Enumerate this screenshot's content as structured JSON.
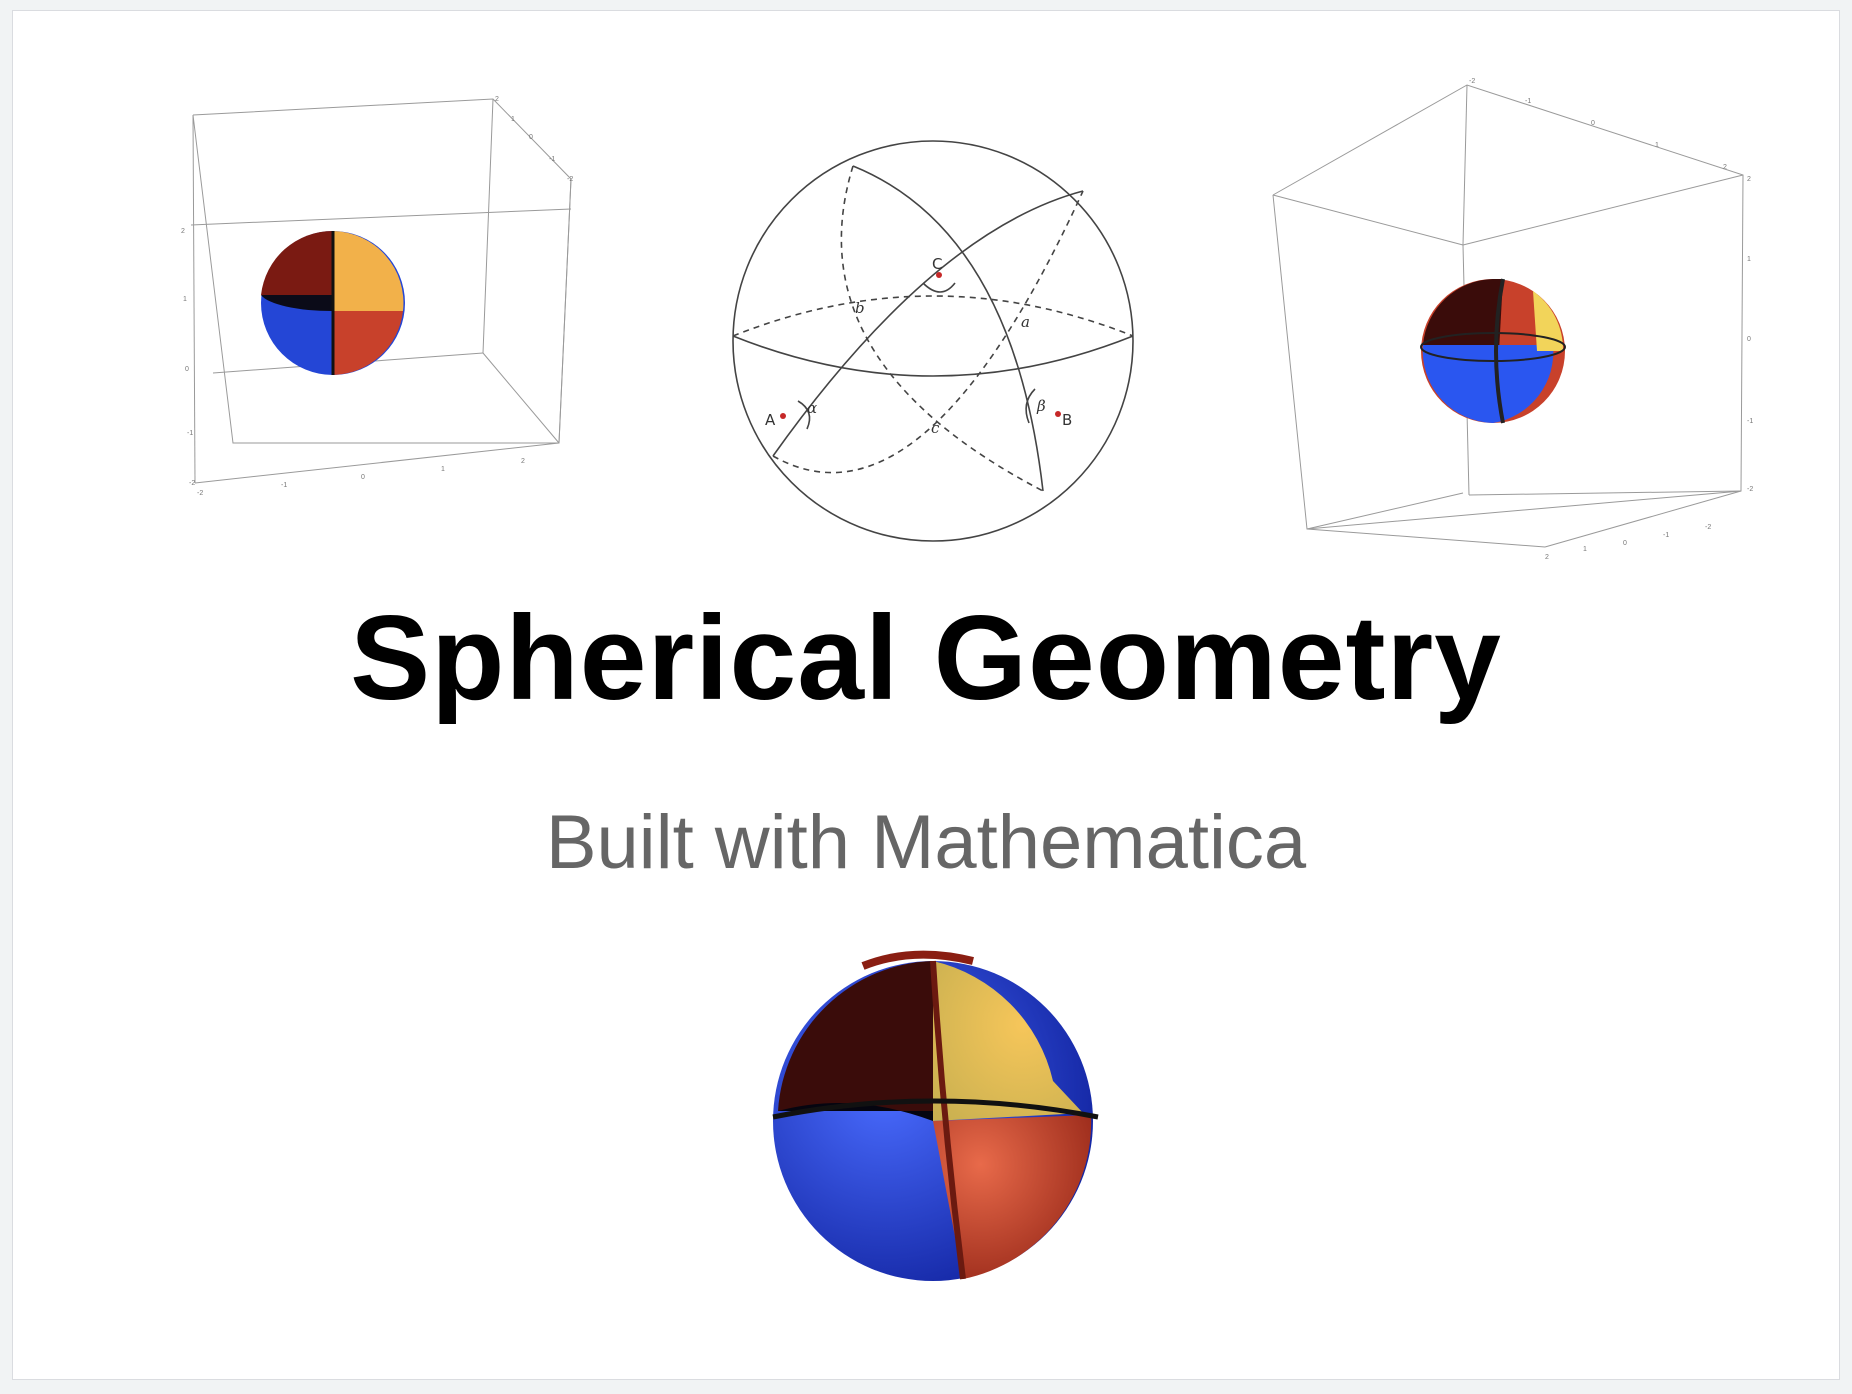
{
  "slide": {
    "title": "Spherical Geometry",
    "subtitle": "Built with Mathematica"
  },
  "figures": {
    "left_box": {
      "tick_labels": [
        "2",
        "1",
        "0",
        "-1",
        "-2"
      ]
    },
    "center_diagram": {
      "vertex_labels": [
        "A",
        "B",
        "C"
      ],
      "side_labels": [
        "a",
        "b",
        "c"
      ],
      "angle_labels": [
        "α",
        "β"
      ]
    },
    "right_box": {
      "tick_labels": [
        "2",
        "1",
        "0",
        "-1",
        "-2"
      ]
    }
  },
  "colors": {
    "red": "#c8412b",
    "blue": "#2446d6",
    "yellow": "#f2c04a",
    "dark": "#1a0a0a"
  }
}
